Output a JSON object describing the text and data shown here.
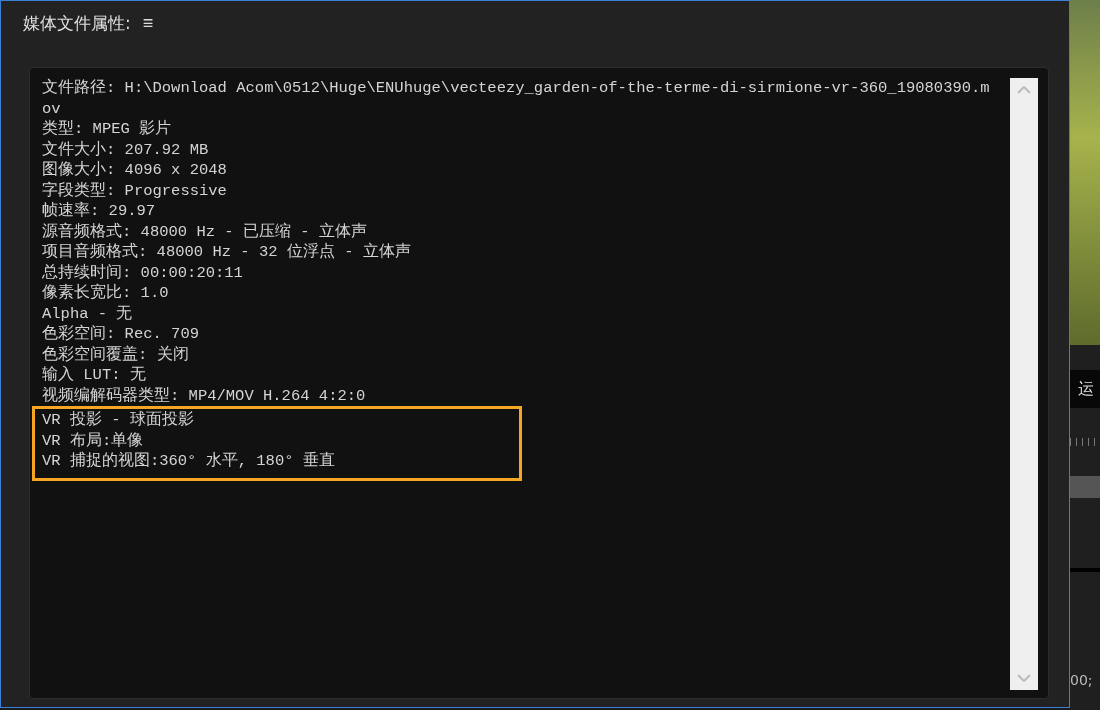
{
  "panel": {
    "title": "媒体文件属性:",
    "menu_icon": "≡"
  },
  "properties": [
    "文件路径: H:\\Download Acom\\0512\\Huge\\ENUhuge\\vecteezy_garden-of-the-terme-di-sirmione-vr-360_19080390.mov",
    "类型: MPEG 影片",
    "文件大小: 207.92 MB",
    "图像大小: 4096 x 2048",
    "字段类型: Progressive",
    "帧速率: 29.97",
    "源音频格式: 48000 Hz - 已压缩 - 立体声",
    "项目音频格式: 48000 Hz - 32 位浮点 - 立体声",
    "总持续时间: 00:00:20:11",
    "像素长宽比: 1.0",
    "Alpha - 无",
    "色彩空间: Rec. 709",
    "色彩空间覆盖: 关闭",
    "输入 LUT: 无",
    "视频编解码器类型: MP4/MOV H.264 4:2:0"
  ],
  "highlighted": [
    "VR 投影 - 球面投影",
    "VR 布局:单像",
    "VR 捕捉的视图:360°  水平, 180°  垂直"
  ],
  "side": {
    "tab_text": "运",
    "timecode": "00;"
  }
}
